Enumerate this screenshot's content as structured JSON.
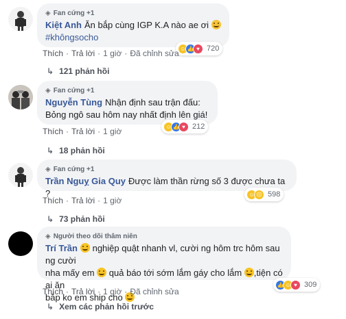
{
  "comments": [
    {
      "badge": "Fan cứng +1",
      "author": "Kiệt Anh",
      "text_line1": "Ăn bắp cùng IGP K.A nào ae ơi",
      "hashtag": "#khôngsocho",
      "actions": {
        "like": "Thích",
        "reply": "Trả lời",
        "time": "1 giờ",
        "edited": "Đã chỉnh sửa"
      },
      "reaction_count": "720",
      "replies": "121 phản hồi"
    },
    {
      "badge": "Fan cứng +1",
      "author": "Nguyễn Tùng",
      "text_line1": "Nhận định sau trận đấu:",
      "text_line2": "Bỏng ngô sau hôm nay nhất định lên giá!",
      "actions": {
        "like": "Thích",
        "reply": "Trả lời",
        "time": "1 giờ"
      },
      "reaction_count": "212",
      "replies": "18 phản hồi"
    },
    {
      "badge": "Fan cứng +1",
      "author": "Trần Nguỵ Gia Quy",
      "text_line1": "Được làm thần rừng số 3 được chưa ta ?",
      "actions": {
        "like": "Thích",
        "reply": "Trả lời",
        "time": "1 giờ"
      },
      "reaction_count": "598",
      "replies": "73 phản hồi"
    },
    {
      "badge": "Người theo dõi thâm niên",
      "author": "Trí Trần",
      "text_line1": "nghiệp quật nhanh vl, cười ng hôm trc hôm sau ng cười",
      "text_line2a": "nha mấy em",
      "text_line2b": "quả báo tới sớm lắm gáy cho lắm",
      "text_line2c": ",tiện có ai ăn",
      "text_line3": "bắp ko em ship cho",
      "actions": {
        "like": "Thích",
        "reply": "Trả lời",
        "time": "1 giờ",
        "edited": "Đã chỉnh sửa"
      },
      "reaction_count": "309"
    }
  ],
  "more_replies": "Xem các phản hồi trước",
  "icons": [
    "diamond-icon",
    "reply-arrow-icon",
    "haha-reaction-icon",
    "like-reaction-icon",
    "love-reaction-icon",
    "sad-reaction-icon",
    "grin-emoji-icon"
  ],
  "colors": {
    "link": "#385898",
    "bubble": "#f2f3f5",
    "meta": "#606770",
    "like_blue": "#3578e5",
    "love_red": "#e9485f",
    "haha_yellow": "#f7c325"
  }
}
